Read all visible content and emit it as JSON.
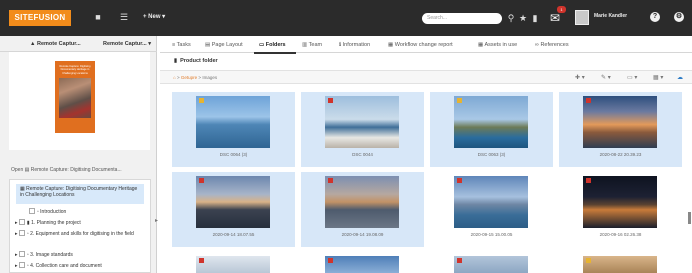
{
  "app": {
    "logo_text": "SITEFUSION",
    "new_label": "New",
    "search_placeholder": "Search...",
    "mail_count": "1",
    "user_name": "Marie Kandler"
  },
  "left_panel": {
    "tabs": [
      "Remote Captur...",
      "Remote Captur..."
    ],
    "book_title": "Remote Capture: Digitising Documentary Heritage in Challenging Locations",
    "open_label": "Open",
    "open_item": "Remote Capture: Digitising Documenta...",
    "tree": [
      "Remote Capture: Digitising Documentary Heritage in Challenging Locations",
      "Introduction",
      "1. Planning the project",
      "2. Equipment and skills for digitising in the field",
      "3. Image standards",
      "4. Collection care and document"
    ]
  },
  "tabs": [
    "Tasks",
    "Page Layout",
    "Folders",
    "Team",
    "Information",
    "Workflow change report",
    "Assets in use",
    "References"
  ],
  "active_tab": "Folders",
  "product_folder": "Product folder",
  "breadcrumb": {
    "home": "⌂",
    "link": "Getupre",
    "sep": ">",
    "current": "Images"
  },
  "tiles": [
    {
      "caption": "DSC 0064 (3)",
      "selected": true,
      "flag": "yellow"
    },
    {
      "caption": "DSC 0044",
      "selected": true,
      "flag": "red"
    },
    {
      "caption": "DSC 0063 (3)",
      "selected": true,
      "flag": "yellow"
    },
    {
      "caption": "2020-08-22 20.39.23",
      "selected": true,
      "flag": "red"
    },
    {
      "caption": "2020-09-14 18.07.55",
      "selected": true,
      "flag": "red"
    },
    {
      "caption": "2020-09-14 19.08.09",
      "selected": true,
      "flag": "red"
    },
    {
      "caption": "2020-09-15 15.00.05",
      "selected": false,
      "flag": "red"
    },
    {
      "caption": "2020-09-16 02.26.38",
      "selected": false,
      "flag": "red"
    },
    {
      "caption": "",
      "selected": false,
      "flag": "red"
    },
    {
      "caption": "",
      "selected": false,
      "flag": "red"
    },
    {
      "caption": "",
      "selected": false,
      "flag": "red"
    },
    {
      "caption": "",
      "selected": false,
      "flag": "yellow"
    }
  ],
  "colors": {
    "brand": "#f28c1b",
    "topbar": "#2b2b2b",
    "selected_tile": "#d7e7f8",
    "flag_red": "#d0342c",
    "flag_yellow": "#e7b431"
  }
}
